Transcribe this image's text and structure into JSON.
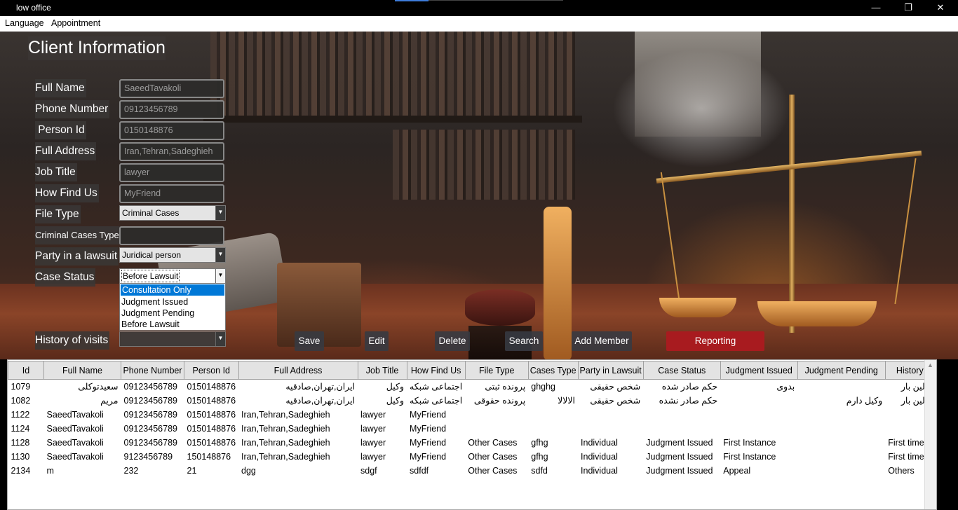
{
  "window": {
    "title": "low office",
    "minimize": "—",
    "maximize": "❐",
    "close": "✕"
  },
  "menu": {
    "items": [
      "Language",
      "Appointment"
    ]
  },
  "form": {
    "heading": "Client Information",
    "labels": {
      "full_name": "Full Name",
      "phone": "Phone Number",
      "person_id": " Person Id",
      "address": "Full Address",
      "job": "Job Title",
      "how_find": "How Find Us",
      "file_type": "File Type",
      "criminal_type": "Criminal Cases Type",
      "party": "Party in a lawsuit",
      "case_status": "Case Status",
      "history": "History of visits"
    },
    "values": {
      "full_name": "SaeedTavakoli",
      "phone": "09123456789",
      "person_id": "0150148876",
      "address": "Iran,Tehran,Sadeghieh",
      "job": "lawyer",
      "how_find": "MyFriend",
      "file_type": "Criminal Cases",
      "criminal_type": "",
      "party": "Juridical person",
      "case_status": "Before Lawsuit",
      "history": ""
    },
    "case_status_options": [
      "Consultation Only",
      "Judgment Issued",
      "Judgment Pending",
      "Before Lawsuit"
    ],
    "case_status_highlighted": "Consultation Only"
  },
  "buttons": {
    "save": "Save",
    "edit": "Edit",
    "delete": "Delete",
    "search": "Search",
    "add_member": "Add Member",
    "reporting": "Reporting"
  },
  "colors": {
    "accent": "#0078d7",
    "reporting": "#a81b1f",
    "titlebar": "#000000"
  },
  "table": {
    "columns": [
      "Id",
      "Full Name",
      "Phone Number",
      "Person Id",
      "Full Address",
      "Job Title",
      "How Find Us",
      "File Type",
      "Cases Type",
      "Party in Lawsuit",
      "Case Status",
      "Judgment Issued",
      "Judgment Pending",
      "History"
    ],
    "rows": [
      [
        "1079",
        "سعیدتوکلی",
        "09123456789",
        "0150148876",
        "ایران,تهران,صادقیه",
        "وکیل",
        "اجتماعی شبکه",
        "پرونده ثبتی",
        "ghghg",
        "شخص حقیقی",
        "حکم صادر شده",
        "بدوی",
        "",
        "اولین بار"
      ],
      [
        "1082",
        "مریم",
        "09123456789",
        "0150148876",
        "ایران,تهران,صادقیه",
        "وکیل",
        "اجتماعی شبکه",
        "پرونده حقوقی",
        "الالالا",
        "شخص حقیقی",
        "حکم صادر نشده",
        "",
        "وکیل دارم",
        "اولین بار"
      ],
      [
        "1122",
        "SaeedTavakoli",
        "09123456789",
        "0150148876",
        "Iran,Tehran,Sadeghieh",
        "lawyer",
        "MyFriend",
        "",
        "",
        "",
        "",
        "",
        "",
        ""
      ],
      [
        "1124",
        "SaeedTavakoli",
        "09123456789",
        "0150148876",
        "Iran,Tehran,Sadeghieh",
        "lawyer",
        "MyFriend",
        "",
        "",
        "",
        "",
        "",
        "",
        ""
      ],
      [
        "1128",
        "SaeedTavakoli",
        "09123456789",
        "0150148876",
        "Iran,Tehran,Sadeghieh",
        "lawyer",
        "MyFriend",
        "Other Cases",
        "gfhg",
        "Individual",
        "Judgment Issued",
        "First Instance",
        "",
        "First time"
      ],
      [
        "1130",
        "SaeedTavakoli",
        "9123456789",
        "150148876",
        "Iran,Tehran,Sadeghieh",
        "lawyer",
        "MyFriend",
        "Other Cases",
        "gfhg",
        "Individual",
        "Judgment Issued",
        "First Instance",
        "",
        "First time"
      ],
      [
        "2134",
        "m",
        "232",
        "21",
        "dgg",
        "sdgf",
        "sdfdf",
        "Other Cases",
        "sdfd",
        "Individual",
        "Judgment Issued",
        "Appeal",
        "",
        "Others"
      ]
    ]
  }
}
